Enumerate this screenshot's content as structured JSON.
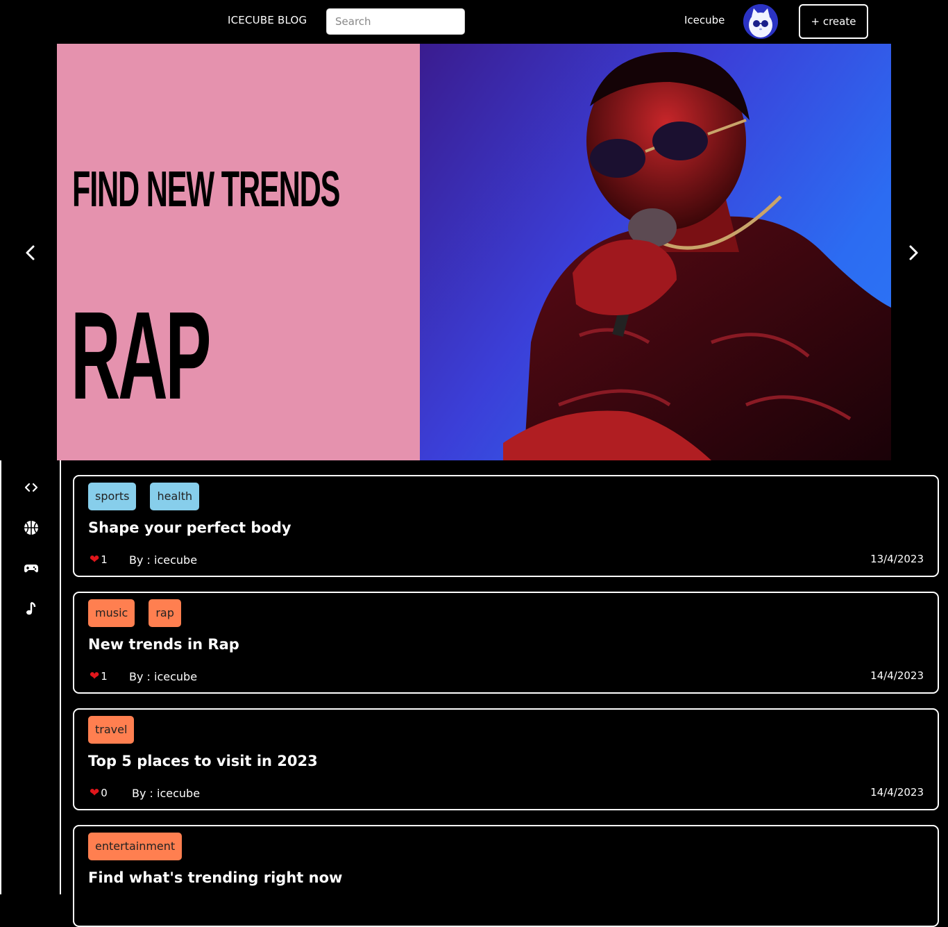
{
  "header": {
    "logo": "ICECUBE BLOG",
    "search_placeholder": "Search",
    "username": "Icecube",
    "create_label": "+ create"
  },
  "hero": {
    "headline": "FIND  NEW TRENDS",
    "genre": "RAP",
    "left_bg": "#e592ae"
  },
  "sidebar": {
    "icons": [
      "code-icon",
      "basketball-icon",
      "gamepad-icon",
      "music-note-icon"
    ]
  },
  "posts": [
    {
      "tags": [
        "sports",
        "health"
      ],
      "tag_color": "#87ceeb",
      "title": "Shape your perfect body",
      "likes": "1",
      "author": "By : icecube",
      "date": "13/4/2023"
    },
    {
      "tags": [
        "music",
        "rap"
      ],
      "tag_color": "#ff7f50",
      "title": "New trends in Rap",
      "likes": "1",
      "author": "By : icecube",
      "date": "14/4/2023"
    },
    {
      "tags": [
        "travel"
      ],
      "tag_color": "#ff7f50",
      "title": "Top 5 places to visit in 2023",
      "likes": "0",
      "author": "By : icecube",
      "date": "14/4/2023"
    },
    {
      "tags": [
        "entertainment"
      ],
      "tag_color": "#ff7f50",
      "title": "Find what's trending right now",
      "likes": "",
      "author": "",
      "date": ""
    }
  ]
}
